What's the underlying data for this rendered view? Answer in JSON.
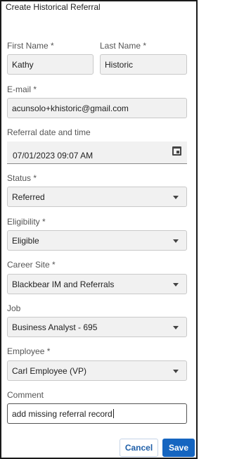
{
  "dialog": {
    "title": "Create Historical Referral"
  },
  "form": {
    "first_name": {
      "label": "First Name *",
      "value": "Kathy"
    },
    "last_name": {
      "label": "Last Name *",
      "value": "Historic"
    },
    "email": {
      "label": "E-mail *",
      "value": "acunsolo+khistoric@gmail.com"
    },
    "referral_date": {
      "label": "Referral date and time",
      "value": "07/01/2023 09:07 AM",
      "icon": "calendar-icon"
    },
    "status": {
      "label": "Status *",
      "value": "Referred"
    },
    "eligibility": {
      "label": "Eligibility *",
      "value": "Eligible"
    },
    "career_site": {
      "label": "Career Site *",
      "value": "Blackbear IM and Referrals"
    },
    "job": {
      "label": "Job",
      "value": "Business Analyst - 695"
    },
    "employee": {
      "label": "Employee *",
      "value": "Carl Employee (VP)"
    },
    "comment": {
      "label": "Comment",
      "value": "add missing referral record"
    }
  },
  "actions": {
    "cancel_label": "Cancel",
    "save_label": "Save"
  },
  "colors": {
    "primary": "#1565c0",
    "field_bg": "#f1f1f1"
  }
}
